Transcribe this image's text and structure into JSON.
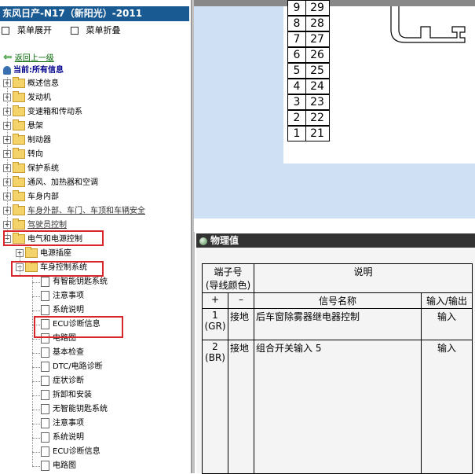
{
  "title": "东风日产-N17（新阳光）-2011",
  "menu": {
    "expand": "菜单展开",
    "collapse": "菜单折叠"
  },
  "nav": {
    "back": "返回上一级",
    "current": "当前:所有信息"
  },
  "tree": {
    "top": [
      "概述信息",
      "发动机",
      "变速箱和传动系",
      "悬架",
      "制动器",
      "转向",
      "保护系统",
      "通风、加热器和空调",
      "车身内部",
      "车身外部、车门、车顶和车辆安全",
      "驾驶员控制",
      "电气和电源控制"
    ],
    "electrical_children": [
      "电源插座",
      "车身控制系统"
    ],
    "body_control_items": [
      "有智能钥匙系统",
      "注意事项",
      "系统说明",
      "ECU诊断信息",
      "电路图",
      "基本检查",
      "DTC/电路诊断",
      "症状诊断",
      "拆卸和安装",
      "无智能钥匙系统",
      "注意事项",
      "系统说明",
      "ECU诊断信息",
      "电路图"
    ]
  },
  "pins": [
    {
      "a": "9",
      "b": "29"
    },
    {
      "a": "8",
      "b": "28"
    },
    {
      "a": "7",
      "b": "27"
    },
    {
      "a": "6",
      "b": "26"
    },
    {
      "a": "5",
      "b": "25"
    },
    {
      "a": "4",
      "b": "24"
    },
    {
      "a": "3",
      "b": "23"
    },
    {
      "a": "2",
      "b": "22"
    },
    {
      "a": "1",
      "b": "21"
    }
  ],
  "phys": {
    "header": "物理值",
    "col_terminal": "端子号",
    "col_wire": "(导线颜色)",
    "col_desc": "说明",
    "col_plus": "+",
    "col_minus": "–",
    "col_signal": "信号名称",
    "col_io": "输入/输出",
    "rows": [
      {
        "plus": "1",
        "plus_color": "(GR)",
        "minus": "接地",
        "signal": "后车窗除雾器继电器控制",
        "io": "输入"
      },
      {
        "plus": "2",
        "plus_color": "(BR)",
        "minus": "接地",
        "signal": "组合开关输入 5",
        "io": "输入"
      }
    ]
  }
}
